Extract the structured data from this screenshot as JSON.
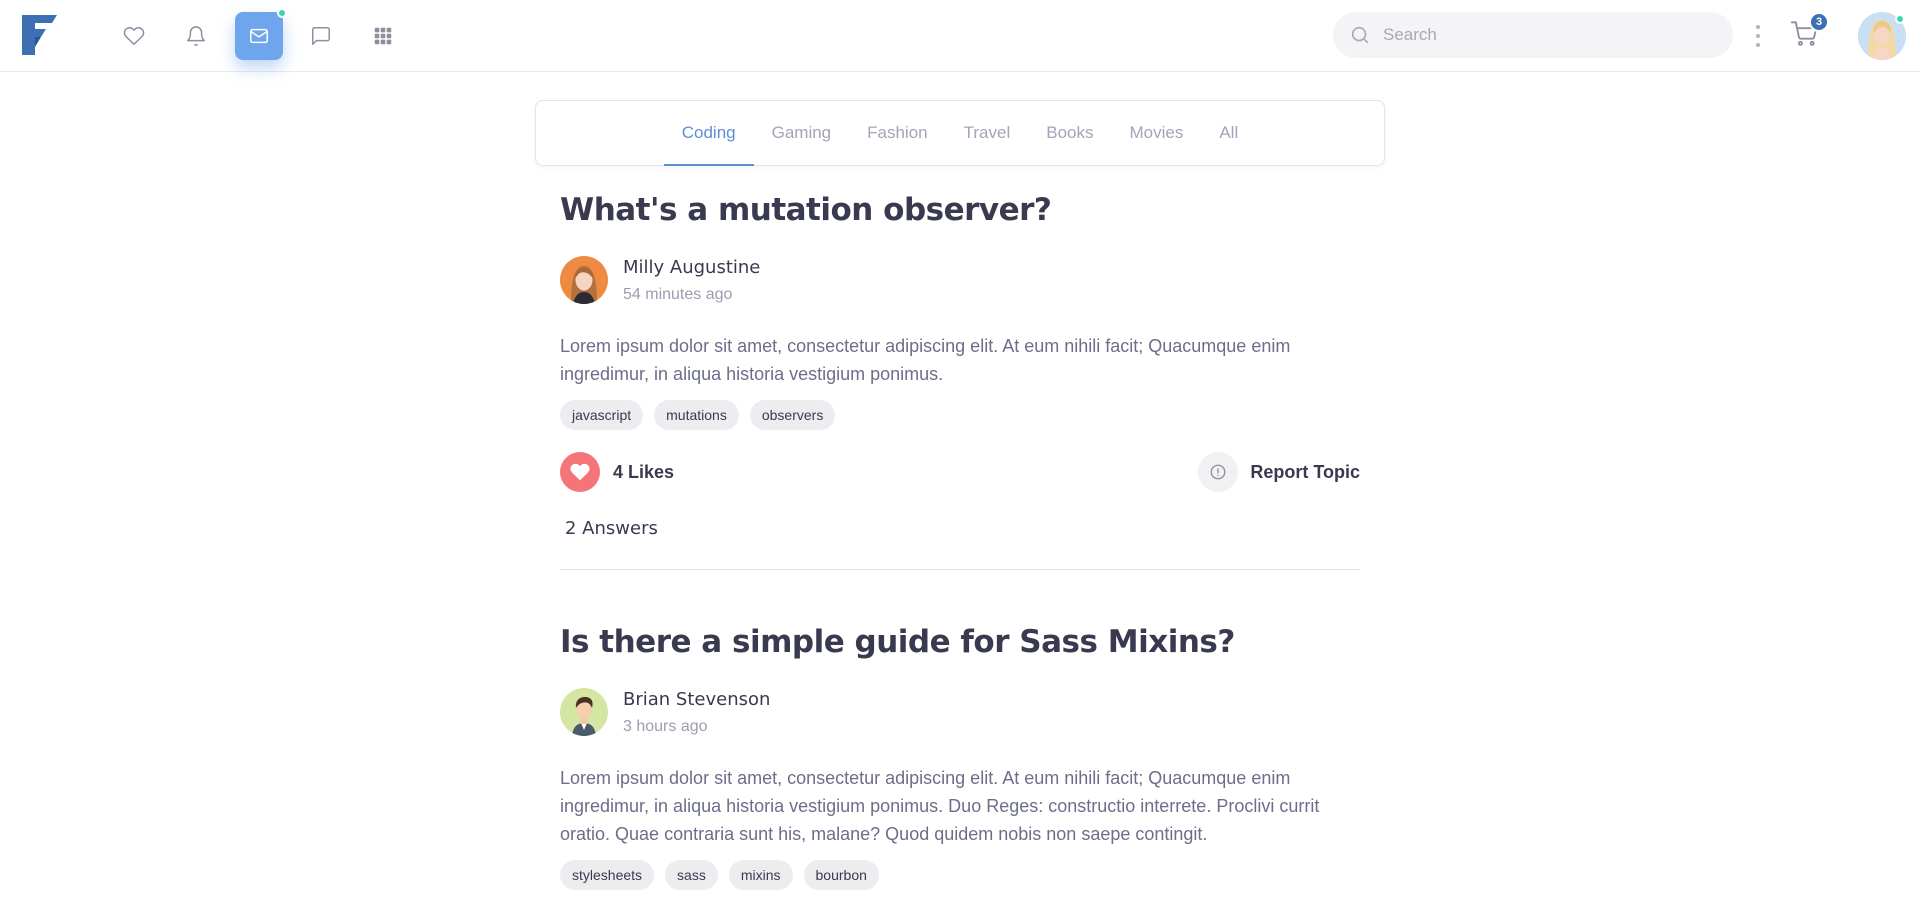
{
  "navbar": {
    "search_placeholder": "Search",
    "cart_count": "3",
    "accent_color": "#6ea5ec",
    "icons": [
      "heart-icon",
      "bell-icon",
      "mail-icon",
      "chat-icon",
      "apps-grid-icon"
    ]
  },
  "tabs": [
    {
      "label": "Coding",
      "active": true
    },
    {
      "label": "Gaming",
      "active": false
    },
    {
      "label": "Fashion",
      "active": false
    },
    {
      "label": "Travel",
      "active": false
    },
    {
      "label": "Books",
      "active": false
    },
    {
      "label": "Movies",
      "active": false
    },
    {
      "label": "All",
      "active": false
    }
  ],
  "topics": [
    {
      "title": "What's a mutation observer?",
      "author": "Milly Augustine",
      "time": "54 minutes ago",
      "body": "Lorem ipsum dolor sit amet, consectetur adipiscing elit. At eum nihili facit; Quacumque enim ingredimur, in aliqua historia vestigium ponimus.",
      "tags": [
        "javascript",
        "mutations",
        "observers"
      ],
      "likes": "4 Likes",
      "report": "Report Topic",
      "answers": "2 Answers"
    },
    {
      "title": "Is there a simple guide for Sass Mixins?",
      "author": "Brian Stevenson",
      "time": "3 hours ago",
      "body": "Lorem ipsum dolor sit amet, consectetur adipiscing elit. At eum nihili facit; Quacumque enim ingredimur, in aliqua historia vestigium ponimus. Duo Reges: constructio interrete. Proclivi currit oratio. Quae contraria sunt his, malane? Quod quidem nobis non saepe contingit.",
      "tags": [
        "stylesheets",
        "sass",
        "mixins",
        "bourbon"
      ]
    }
  ]
}
